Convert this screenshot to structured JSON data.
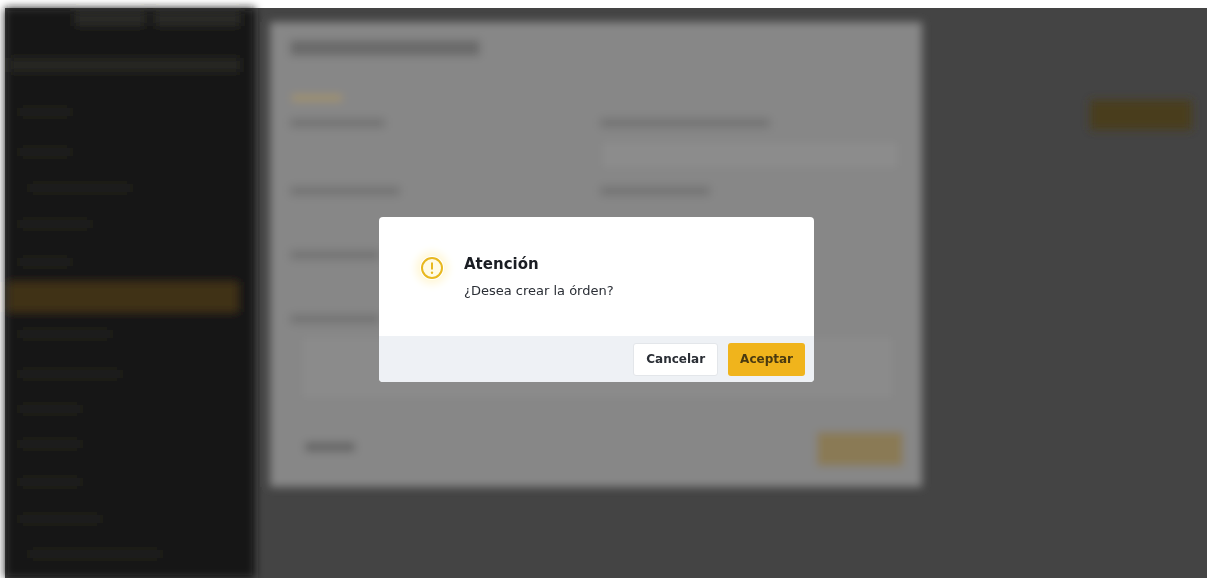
{
  "dialog": {
    "title": "Atención",
    "message": "¿Desea crear la órden?",
    "buttons": [
      {
        "label": "Cancelar",
        "kind": "secondary"
      },
      {
        "label": "Aceptar",
        "kind": "primary"
      }
    ]
  }
}
